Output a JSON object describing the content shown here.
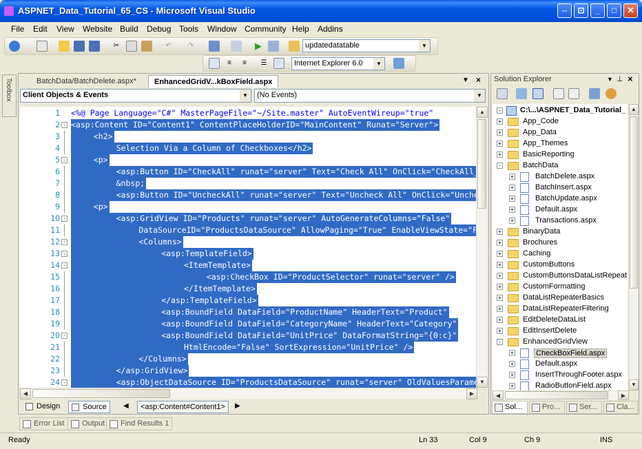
{
  "window": {
    "title": "ASPNET_Data_Tutorial_65_CS - Microsoft Visual Studio"
  },
  "menu": [
    "File",
    "Edit",
    "View",
    "Website",
    "Build",
    "Debug",
    "Tools",
    "Window",
    "Community",
    "Help",
    "Addins"
  ],
  "toolbar": {
    "config_combo": "updatedatatable",
    "browser_combo": "Internet Explorer 6.0"
  },
  "toolbox": {
    "label": "Toolbox"
  },
  "editor": {
    "tabs": [
      {
        "label": "BatchData/BatchDelete.aspx*",
        "active": false
      },
      {
        "label": "EnhancedGridV...kBoxField.aspx",
        "active": true
      }
    ],
    "objects_combo": "Client Objects & Events",
    "events_combo": "(No Events)",
    "lines": [
      {
        "n": "1",
        "fold": "none",
        "indent": 0,
        "sel": false,
        "text": "<%@ Page Language=\"C#\" MasterPageFile=\"~/Site.master\" AutoEventWireup=\"true\""
      },
      {
        "n": "2",
        "fold": "minus",
        "indent": 0,
        "sel": true,
        "text": "<asp:Content ID=\"Content1\" ContentPlaceHolderID=\"MainContent\" Runat=\"Server\">"
      },
      {
        "n": "3",
        "fold": "line",
        "indent": 4,
        "sel": true,
        "text": "<h2>"
      },
      {
        "n": "4",
        "fold": "line",
        "indent": 8,
        "sel": true,
        "text": "Selection Via a Column of Checkboxes</h2>"
      },
      {
        "n": "5",
        "fold": "minus",
        "indent": 4,
        "sel": true,
        "text": "<p>"
      },
      {
        "n": "6",
        "fold": "line",
        "indent": 8,
        "sel": true,
        "text": "<asp:Button ID=\"CheckAll\" runat=\"server\" Text=\"Check All\" OnClick=\"CheckAll_Click\" />"
      },
      {
        "n": "7",
        "fold": "line",
        "indent": 8,
        "sel": true,
        "text": "&nbsp;"
      },
      {
        "n": "8",
        "fold": "line",
        "indent": 8,
        "sel": true,
        "text": "<asp:Button ID=\"UncheckAll\" runat=\"server\" Text=\"Uncheck All\" OnClick=\"UncheckAll_Click\" />"
      },
      {
        "n": "9",
        "fold": "line",
        "indent": 4,
        "sel": true,
        "text": "<p>"
      },
      {
        "n": "10",
        "fold": "minus",
        "indent": 8,
        "sel": true,
        "text": "<asp:GridView ID=\"Products\" runat=\"server\" AutoGenerateColumns=\"False\""
      },
      {
        "n": "11",
        "fold": "line",
        "indent": 12,
        "sel": true,
        "text": "DataSourceID=\"ProductsDataSource\" AllowPaging=\"True\" EnableViewState=\"False\">"
      },
      {
        "n": "12",
        "fold": "minus",
        "indent": 12,
        "sel": true,
        "text": "<Columns>"
      },
      {
        "n": "13",
        "fold": "minus",
        "indent": 16,
        "sel": true,
        "text": "<asp:TemplateField>"
      },
      {
        "n": "14",
        "fold": "minus",
        "indent": 20,
        "sel": true,
        "text": "<ItemTemplate>"
      },
      {
        "n": "15",
        "fold": "line",
        "indent": 24,
        "sel": true,
        "text": "<asp:CheckBox ID=\"ProductSelector\" runat=\"server\" />"
      },
      {
        "n": "16",
        "fold": "line",
        "indent": 20,
        "sel": true,
        "text": "</ItemTemplate>"
      },
      {
        "n": "17",
        "fold": "line",
        "indent": 16,
        "sel": true,
        "text": "</asp:TemplateField>"
      },
      {
        "n": "18",
        "fold": "line",
        "indent": 16,
        "sel": true,
        "text": "<asp:BoundField DataField=\"ProductName\" HeaderText=\"Product\""
      },
      {
        "n": "19",
        "fold": "line",
        "indent": 16,
        "sel": true,
        "text": "<asp:BoundField DataField=\"CategoryName\" HeaderText=\"Category\""
      },
      {
        "n": "20",
        "fold": "minus",
        "indent": 16,
        "sel": true,
        "text": "<asp:BoundField DataField=\"UnitPrice\" DataFormatString=\"{0:c}\""
      },
      {
        "n": "21",
        "fold": "line",
        "indent": 20,
        "sel": true,
        "text": "HtmlEncode=\"False\" SortExpression=\"UnitPrice\" />"
      },
      {
        "n": "22",
        "fold": "line",
        "indent": 12,
        "sel": true,
        "text": "</Columns>"
      },
      {
        "n": "23",
        "fold": "line",
        "indent": 8,
        "sel": true,
        "text": "</asp:GridView>"
      },
      {
        "n": "24",
        "fold": "minus",
        "indent": 8,
        "sel": true,
        "text": "<asp:ObjectDataSource ID=\"ProductsDataSource\" runat=\"server\" OldValuesParameterFormatString"
      }
    ],
    "view_design": "Design",
    "view_source": "Source",
    "breadcrumb": "<asp:Content#Content1>"
  },
  "bottom_tabs": [
    "Error List",
    "Output",
    "Find Results 1"
  ],
  "solution_explorer": {
    "title": "Solution Explorer",
    "project": "C:\\...\\ASPNET_Data_Tutorial_",
    "items": [
      {
        "label": "App_Code",
        "level": 1,
        "kind": "folder",
        "exp": "+"
      },
      {
        "label": "App_Data",
        "level": 1,
        "kind": "folder",
        "exp": "+"
      },
      {
        "label": "App_Themes",
        "level": 1,
        "kind": "folder",
        "exp": "+"
      },
      {
        "label": "BasicReporting",
        "level": 1,
        "kind": "folder",
        "exp": "+"
      },
      {
        "label": "BatchData",
        "level": 1,
        "kind": "folder",
        "exp": "-"
      },
      {
        "label": "BatchDelete.aspx",
        "level": 2,
        "kind": "file",
        "exp": "+"
      },
      {
        "label": "BatchInsert.aspx",
        "level": 2,
        "kind": "file",
        "exp": "+"
      },
      {
        "label": "BatchUpdate.aspx",
        "level": 2,
        "kind": "file",
        "exp": "+"
      },
      {
        "label": "Default.aspx",
        "level": 2,
        "kind": "file",
        "exp": "+"
      },
      {
        "label": "Transactions.aspx",
        "level": 2,
        "kind": "file",
        "exp": "+"
      },
      {
        "label": "BinaryData",
        "level": 1,
        "kind": "folder",
        "exp": "+"
      },
      {
        "label": "Brochures",
        "level": 1,
        "kind": "folder",
        "exp": "+"
      },
      {
        "label": "Caching",
        "level": 1,
        "kind": "folder",
        "exp": "+"
      },
      {
        "label": "CustomButtons",
        "level": 1,
        "kind": "folder",
        "exp": "+"
      },
      {
        "label": "CustomButtonsDataListRepeat",
        "level": 1,
        "kind": "folder",
        "exp": "+"
      },
      {
        "label": "CustomFormatting",
        "level": 1,
        "kind": "folder",
        "exp": "+"
      },
      {
        "label": "DataListRepeaterBasics",
        "level": 1,
        "kind": "folder",
        "exp": "+"
      },
      {
        "label": "DataListRepeaterFiltering",
        "level": 1,
        "kind": "folder",
        "exp": "+"
      },
      {
        "label": "EditDeleteDataList",
        "level": 1,
        "kind": "folder",
        "exp": "+"
      },
      {
        "label": "EditInsertDelete",
        "level": 1,
        "kind": "folder",
        "exp": "+"
      },
      {
        "label": "EnhancedGridView",
        "level": 1,
        "kind": "folder",
        "exp": "-"
      },
      {
        "label": "CheckBoxField.aspx",
        "level": 2,
        "kind": "file",
        "exp": "+",
        "selected": true
      },
      {
        "label": "Default.aspx",
        "level": 2,
        "kind": "file",
        "exp": "+"
      },
      {
        "label": "InsertThroughFooter.aspx",
        "level": 2,
        "kind": "file",
        "exp": "+"
      },
      {
        "label": "RadioButtonField.aspx",
        "level": 2,
        "kind": "file",
        "exp": "+"
      }
    ],
    "tabs": [
      "Sol...",
      "Pro...",
      "Ser...",
      "Cla..."
    ]
  },
  "status": {
    "ready": "Ready",
    "ln": "Ln 33",
    "col": "Col 9",
    "ch": "Ch 9",
    "mode": "INS"
  }
}
